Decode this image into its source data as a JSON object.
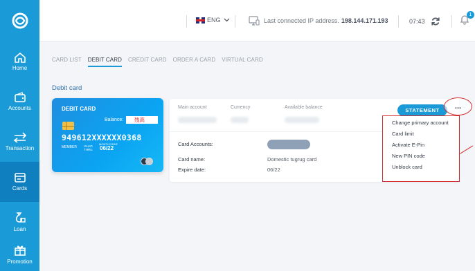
{
  "sidebar": {
    "items": [
      {
        "label": "Home",
        "icon": "home-icon"
      },
      {
        "label": "Accounts",
        "icon": "wallet-icon"
      },
      {
        "label": "Transaction",
        "icon": "transfer-icon"
      },
      {
        "label": "Cards",
        "icon": "card-icon",
        "active": true
      },
      {
        "label": "Loan",
        "icon": "loan-icon"
      },
      {
        "label": "Promotion",
        "icon": "gift-icon"
      }
    ]
  },
  "header": {
    "language": "ENG",
    "ip_label": "Last connected IP address.",
    "ip_value": "198.144.171.193",
    "time": "07:43",
    "notification_count": "1"
  },
  "tabs": [
    "CARD LIST",
    "DEBIT CARD",
    "CREDIT CARD",
    "ORDER A CARD",
    "VIRTUAL CARD"
  ],
  "active_tab": "DEBIT CARD",
  "section_title": "Debit card",
  "card": {
    "type": "DEBIT CARD",
    "balance_label": "Balance:",
    "balance_value": "残高",
    "number": "949612XXXXXX0368",
    "member_label": "MEMBER",
    "valid_label": "VALID",
    "thru_label": "THRU",
    "month_year_label": "MONTH/YEAR",
    "expiry": "06/22"
  },
  "panel": {
    "headers": [
      "Main account",
      "Currency",
      "Available balance"
    ],
    "rows": [
      {
        "label": "Card Accounts:",
        "value": ""
      },
      {
        "label": "Card name:",
        "value": "Domestic tugrug card"
      },
      {
        "label": "Expire date:",
        "value": "06/22"
      }
    ]
  },
  "statement_label": "STATEMENT",
  "more_label": "...",
  "menu": {
    "items": [
      "Change primary account",
      "Card limit",
      "Activate E-Pin",
      "New PIN code",
      "Unblock card"
    ]
  },
  "colors": {
    "brand": "#1a9bd7",
    "highlight": "#d22a2a"
  }
}
